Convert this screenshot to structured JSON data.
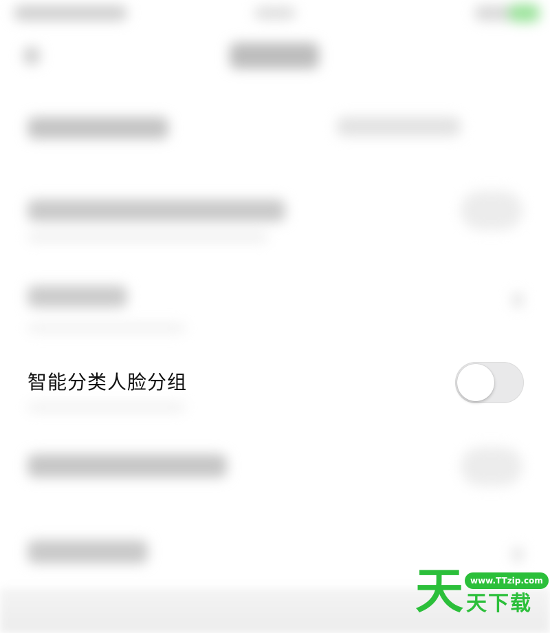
{
  "settings": {
    "smart_face_grouping": {
      "label": "智能分类人脸分组",
      "enabled": false
    }
  },
  "watermark": {
    "big_char": "天",
    "url": "www.TTzip.com",
    "text": "天下载"
  },
  "colors": {
    "toggle_off_track": "#e9e9ea",
    "toggle_knob": "#ffffff",
    "watermark_green": "#2bbf3a",
    "label_text": "#111111"
  }
}
